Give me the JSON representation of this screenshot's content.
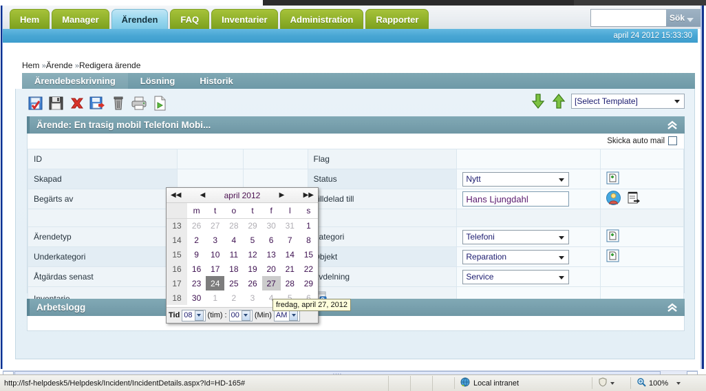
{
  "nav": {
    "tabs": [
      {
        "label": "Hem",
        "active": false
      },
      {
        "label": "Manager",
        "active": false
      },
      {
        "label": "Ärenden",
        "active": true
      },
      {
        "label": "FAQ",
        "active": false
      },
      {
        "label": "Inventarier",
        "active": false
      },
      {
        "label": "Administration",
        "active": false
      },
      {
        "label": "Rapporter",
        "active": false
      }
    ],
    "search_value": "",
    "search_button": "Sök"
  },
  "datebar": {
    "datetime": "april 24 2012 15:33:30"
  },
  "breadcrumb": {
    "home": "Hem",
    "sep": "»",
    "level2": "Ärende",
    "current": "Redigera ärende"
  },
  "module_tabs": [
    {
      "label": "Ärendebeskrivning",
      "active": true
    },
    {
      "label": "Lösning",
      "active": false
    },
    {
      "label": "Historik",
      "active": false
    }
  ],
  "toolbar": {
    "icons": [
      {
        "name": "save-check-icon",
        "title": "Spara"
      },
      {
        "name": "floppy-save-icon",
        "title": "Spara"
      },
      {
        "name": "delete-red-x-icon",
        "title": "Ta bort"
      },
      {
        "name": "save-close-icon",
        "title": "Spara och stäng"
      },
      {
        "name": "trash-icon",
        "title": "Papperskorg"
      },
      {
        "name": "print-icon",
        "title": "Skriv ut"
      },
      {
        "name": "new-document-icon",
        "title": "Nytt"
      }
    ],
    "import_icon": "arrow-down-green-icon",
    "export_icon": "arrow-up-green-icon",
    "template_select": "[Select Template]"
  },
  "section": {
    "title": "Ärende: En trasig mobil Telefoni Mobi...",
    "collapse_icon": "chevron-double-up-icon",
    "auto_mail_label": "Skicka auto mail",
    "auto_mail_checked": false
  },
  "form": {
    "rows": [
      {
        "left_label": "ID",
        "right_label": "Flag",
        "right_type": "none",
        "right_value": "",
        "icons": []
      },
      {
        "left_label": "Skapad",
        "right_label": "Status",
        "right_type": "select",
        "right_value": "Nytt",
        "icons": [
          "new-page-icon"
        ]
      },
      {
        "left_label": "Begärts av",
        "right_label": "Tilldelad till",
        "right_type": "text",
        "right_value": "Hans Ljungdahl",
        "icons": [
          "user-icon",
          "notes-arrow-icon"
        ]
      },
      {
        "left_label": "",
        "right_label": "",
        "right_type": "none",
        "right_value": "",
        "icons": []
      },
      {
        "left_label": "Ärendetyp",
        "right_label": "Kategori",
        "right_type": "select",
        "right_value": "Telefoni",
        "icons": [
          "new-page-icon"
        ]
      },
      {
        "left_label": "Underkategori",
        "right_label": "Objekt",
        "right_type": "select",
        "right_value": "Reparation",
        "icons": [
          "new-page-icon"
        ]
      },
      {
        "left_label": "Åtgärdas senast",
        "right_label": "Avdelning",
        "right_type": "select",
        "right_value": "Service",
        "icons": []
      },
      {
        "left_label": "Inventarie",
        "right_label": "",
        "right_type": "none",
        "right_value": "",
        "icons": []
      }
    ],
    "date_input_value": "",
    "date_picker_icon": "calendar-icon",
    "inventory_input_value": "",
    "inventory_lookup_icon": "search-window-icon",
    "mail_icon": "mail-check-icon",
    "blue_button_icon": "blue-square-button"
  },
  "calendar": {
    "nav_first": "◀◀",
    "nav_prev": "◀",
    "title": "april 2012",
    "nav_next": "▶",
    "nav_last": "▶▶",
    "day_headers": [
      "m",
      "t",
      "o",
      "t",
      "f",
      "l",
      "s"
    ],
    "weeks": [
      {
        "wk": "13",
        "days": [
          {
            "d": "26",
            "state": "other"
          },
          {
            "d": "27",
            "state": "other"
          },
          {
            "d": "28",
            "state": "other"
          },
          {
            "d": "29",
            "state": "other"
          },
          {
            "d": "30",
            "state": "other"
          },
          {
            "d": "31",
            "state": "other"
          },
          {
            "d": "1",
            "state": "normal"
          }
        ]
      },
      {
        "wk": "14",
        "days": [
          {
            "d": "2",
            "state": "normal"
          },
          {
            "d": "3",
            "state": "normal"
          },
          {
            "d": "4",
            "state": "normal"
          },
          {
            "d": "5",
            "state": "normal"
          },
          {
            "d": "6",
            "state": "normal"
          },
          {
            "d": "7",
            "state": "normal"
          },
          {
            "d": "8",
            "state": "normal"
          }
        ]
      },
      {
        "wk": "15",
        "days": [
          {
            "d": "9",
            "state": "normal"
          },
          {
            "d": "10",
            "state": "normal"
          },
          {
            "d": "11",
            "state": "normal"
          },
          {
            "d": "12",
            "state": "normal"
          },
          {
            "d": "13",
            "state": "normal"
          },
          {
            "d": "14",
            "state": "normal"
          },
          {
            "d": "15",
            "state": "normal"
          }
        ]
      },
      {
        "wk": "16",
        "days": [
          {
            "d": "16",
            "state": "normal"
          },
          {
            "d": "17",
            "state": "normal"
          },
          {
            "d": "18",
            "state": "normal"
          },
          {
            "d": "19",
            "state": "normal"
          },
          {
            "d": "20",
            "state": "normal"
          },
          {
            "d": "21",
            "state": "normal"
          },
          {
            "d": "22",
            "state": "normal"
          }
        ]
      },
      {
        "wk": "17",
        "days": [
          {
            "d": "23",
            "state": "normal"
          },
          {
            "d": "24",
            "state": "today"
          },
          {
            "d": "25",
            "state": "normal"
          },
          {
            "d": "26",
            "state": "normal"
          },
          {
            "d": "27",
            "state": "hover"
          },
          {
            "d": "28",
            "state": "normal"
          },
          {
            "d": "29",
            "state": "normal"
          }
        ]
      },
      {
        "wk": "18",
        "days": [
          {
            "d": "30",
            "state": "normal"
          },
          {
            "d": "1",
            "state": "other"
          },
          {
            "d": "2",
            "state": "other"
          },
          {
            "d": "3",
            "state": "other"
          },
          {
            "d": "4",
            "state": "other"
          },
          {
            "d": "5",
            "state": "other"
          },
          {
            "d": "6",
            "state": "other"
          }
        ]
      }
    ],
    "time_label": "Tid",
    "hour_value": "08",
    "hour_suffix": "(tim)",
    "separator": ":",
    "minute_value": "00",
    "minute_suffix": "(Min)",
    "ampm_value": "AM",
    "tooltip": "fredag, april 27, 2012"
  },
  "worklog": {
    "title": "Arbetslogg",
    "collapse_icon": "chevron-double-up-icon"
  },
  "statusbar": {
    "url": "http://lsf-helpdesk5/Helpdesk/Incident/IncidentDetails.aspx?Id=HD-165#",
    "zone": "Local intranet",
    "zone_icon": "globe-icon",
    "security_icon": "security-icon",
    "zoom_icon": "magnifier-icon",
    "zoom_level": "100%"
  }
}
